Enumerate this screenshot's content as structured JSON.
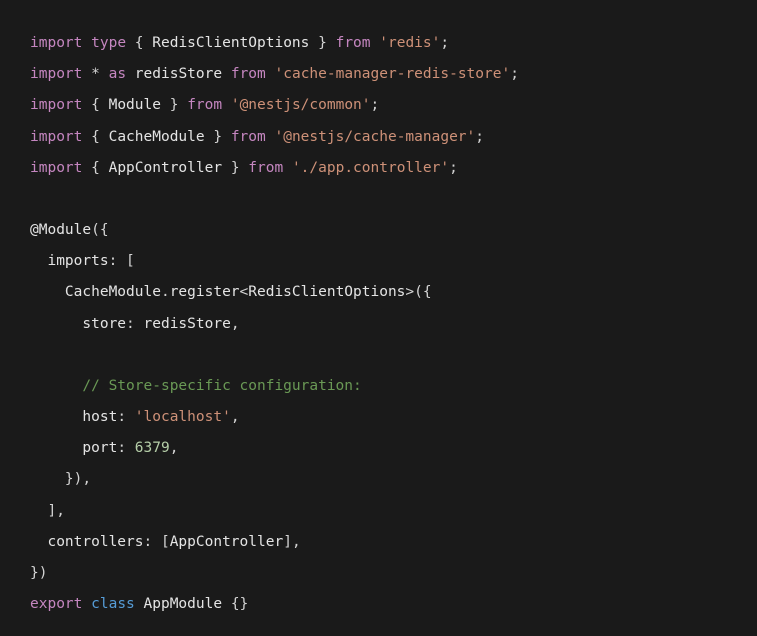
{
  "code": {
    "line1": {
      "kw_import": "import",
      "kw_type": "type",
      "brace_open": "{",
      "type_name": "RedisClientOptions",
      "brace_close": "}",
      "kw_from": "from",
      "module": "'redis'",
      "semi": ";"
    },
    "line2": {
      "kw_import": "import",
      "star": "*",
      "kw_as": "as",
      "alias": "redisStore",
      "kw_from": "from",
      "module": "'cache-manager-redis-store'",
      "semi": ";"
    },
    "line3": {
      "kw_import": "import",
      "brace_open": "{",
      "name": "Module",
      "brace_close": "}",
      "kw_from": "from",
      "module": "'@nestjs/common'",
      "semi": ";"
    },
    "line4": {
      "kw_import": "import",
      "brace_open": "{",
      "name": "CacheModule",
      "brace_close": "}",
      "kw_from": "from",
      "module": "'@nestjs/cache-manager'",
      "semi": ";"
    },
    "line5": {
      "kw_import": "import",
      "brace_open": "{",
      "name": "AppController",
      "brace_close": "}",
      "kw_from": "from",
      "module": "'./app.controller'",
      "semi": ";"
    },
    "line7": {
      "decorator": "@Module",
      "paren_open": "(",
      "brace_open": "{"
    },
    "line8": {
      "indent": "  ",
      "prop": "imports",
      "colon": ":",
      "bracket_open": "["
    },
    "line9": {
      "indent": "    ",
      "class_name": "CacheModule",
      "dot": ".",
      "method": "register",
      "angle_open": "<",
      "generic": "RedisClientOptions",
      "angle_close": ">",
      "paren_open": "(",
      "brace_open": "{"
    },
    "line10": {
      "indent": "      ",
      "prop": "store",
      "colon": ":",
      "value": "redisStore",
      "comma": ","
    },
    "line12": {
      "indent": "      ",
      "comment": "// Store-specific configuration:"
    },
    "line13": {
      "indent": "      ",
      "prop": "host",
      "colon": ":",
      "value": "'localhost'",
      "comma": ","
    },
    "line14": {
      "indent": "      ",
      "prop": "port",
      "colon": ":",
      "value": "6379",
      "comma": ","
    },
    "line15": {
      "indent": "    ",
      "brace_close": "}",
      "paren_close": ")",
      "comma": ","
    },
    "line16": {
      "indent": "  ",
      "bracket_close": "]",
      "comma": ","
    },
    "line17": {
      "indent": "  ",
      "prop": "controllers",
      "colon": ":",
      "bracket_open": "[",
      "value": "AppController",
      "bracket_close": "]",
      "comma": ","
    },
    "line18": {
      "brace_close": "}",
      "paren_close": ")"
    },
    "line19": {
      "kw_export": "export",
      "kw_class": "class",
      "class_name": "AppModule",
      "brace_open": "{",
      "brace_close": "}"
    }
  }
}
